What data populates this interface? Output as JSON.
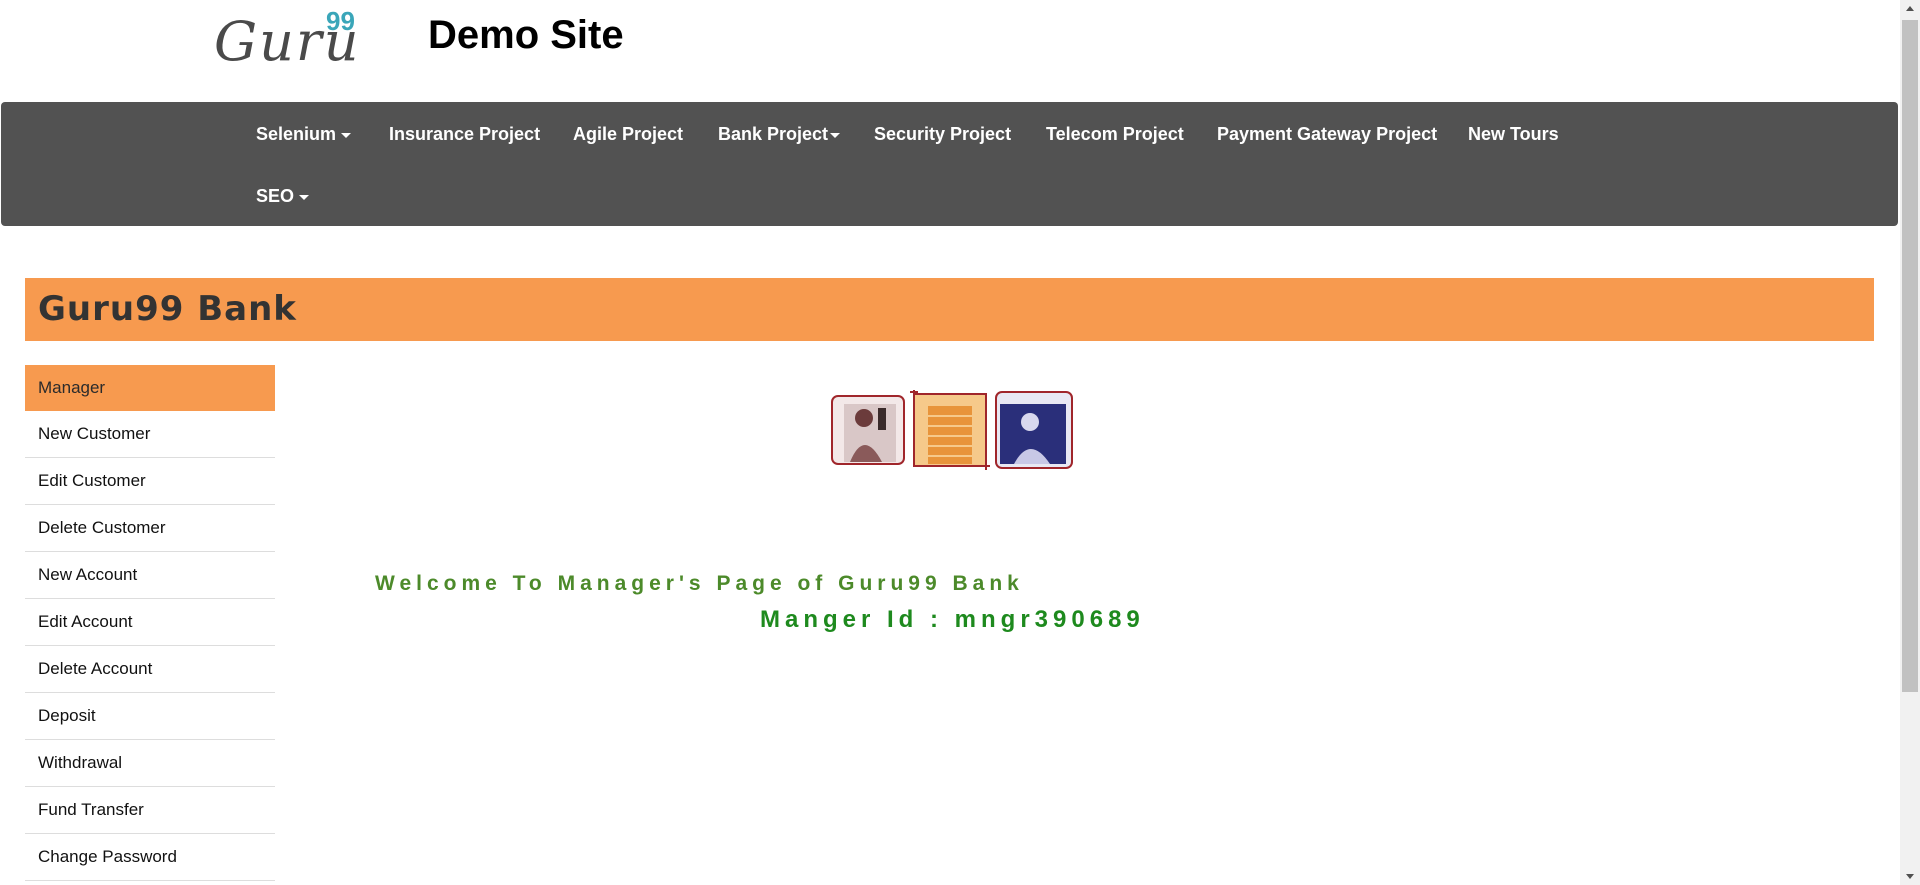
{
  "header": {
    "logo_text": "Guru",
    "logo_sup": "99",
    "title": "Demo Site"
  },
  "nav": {
    "selenium": "Selenium",
    "insurance": "Insurance Project",
    "agile": "Agile Project",
    "bank": "Bank Project",
    "security": "Security Project",
    "telecom": "Telecom Project",
    "payment": "Payment Gateway Project",
    "new_tours": "New Tours",
    "seo": "SEO"
  },
  "bank": {
    "title": "Guru99 Bank"
  },
  "sidebar": {
    "items": [
      "Manager",
      "New Customer",
      "Edit Customer",
      "Delete Customer",
      "New Account",
      "Edit Account",
      "Delete Account",
      "Deposit",
      "Withdrawal",
      "Fund Transfer",
      "Change Password"
    ]
  },
  "main": {
    "welcome": "Welcome To Manager's Page of Guru99 Bank",
    "manager_id": "Manger Id : mngr390689"
  },
  "colors": {
    "nav_bg": "#525252",
    "accent_orange": "#f79a4f",
    "welcome_green": "#4c8a2a",
    "id_green": "#1e8a1e"
  }
}
